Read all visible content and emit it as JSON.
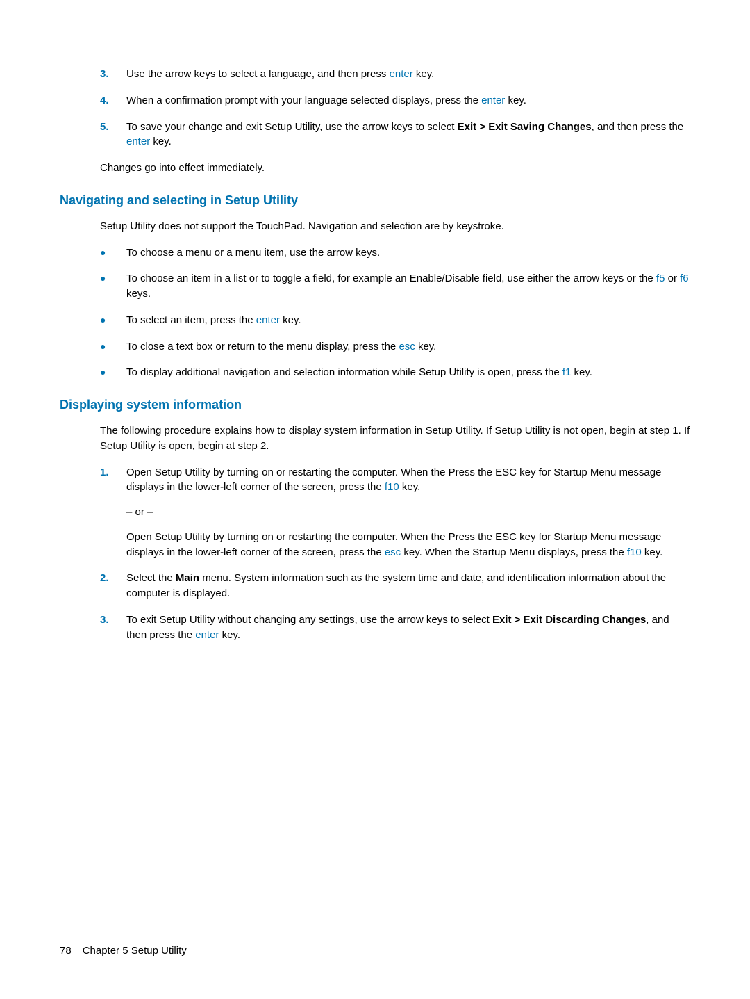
{
  "steps_top": [
    {
      "num": "3.",
      "text_before": "Use the arrow keys to select a language, and then press ",
      "key": "enter",
      "text_after": " key."
    },
    {
      "num": "4.",
      "text_before": "When a confirmation prompt with your language selected displays, press the ",
      "key": "enter",
      "text_after": " key."
    },
    {
      "num": "5.",
      "text_before": "To save your change and exit Setup Utility, use the arrow keys to select ",
      "bold": "Exit > Exit Saving Changes",
      "mid": ", and then press the ",
      "key": "enter",
      "text_after": " key."
    }
  ],
  "para_effect": "Changes go into effect immediately.",
  "heading_nav": "Navigating and selecting in Setup Utility",
  "para_nav_intro": "Setup Utility does not support the TouchPad. Navigation and selection are by keystroke.",
  "bullets": [
    {
      "text_before": "To choose a menu or a menu item, use the arrow keys."
    },
    {
      "text_before": "To choose an item in a list or to toggle a field, for example an Enable/Disable field, use either the arrow keys or the ",
      "key1": "f5",
      "mid": " or ",
      "key2": "f6",
      "text_after": " keys."
    },
    {
      "text_before": "To select an item, press the ",
      "key1": "enter",
      "text_after": " key."
    },
    {
      "text_before": "To close a text box or return to the menu display, press the ",
      "key1": "esc",
      "text_after": " key."
    },
    {
      "text_before": "To display additional navigation and selection information while Setup Utility is open, press the ",
      "key1": "f1",
      "text_after": " key."
    }
  ],
  "heading_disp": "Displaying system information",
  "para_disp_intro": "The following procedure explains how to display system information in Setup Utility. If Setup Utility is not open, begin at step 1. If Setup Utility is open, begin at step 2.",
  "step1": {
    "num": "1.",
    "p1_a": "Open Setup Utility by turning on or restarting the computer. When the Press the ESC key for Startup Menu message displays in the lower-left corner of the screen, press the ",
    "p1_key": "f10",
    "p1_b": " key.",
    "or": "– or –",
    "p2_a": "Open Setup Utility by turning on or restarting the computer. When the Press the ESC key for Startup Menu message displays in the lower-left corner of the screen, press the ",
    "p2_key1": "esc",
    "p2_b": " key. When the Startup Menu displays, press the ",
    "p2_key2": "f10",
    "p2_c": " key."
  },
  "step2": {
    "num": "2.",
    "a": "Select the ",
    "bold": "Main",
    "b": " menu. System information such as the system time and date, and identification information about the computer is displayed."
  },
  "step3": {
    "num": "3.",
    "a": "To exit Setup Utility without changing any settings, use the arrow keys to select ",
    "bold": "Exit > Exit Discarding Changes",
    "b": ", and then press the ",
    "key": "enter",
    "c": " key."
  },
  "footer": {
    "page": "78",
    "chapter": "Chapter 5   Setup Utility"
  }
}
